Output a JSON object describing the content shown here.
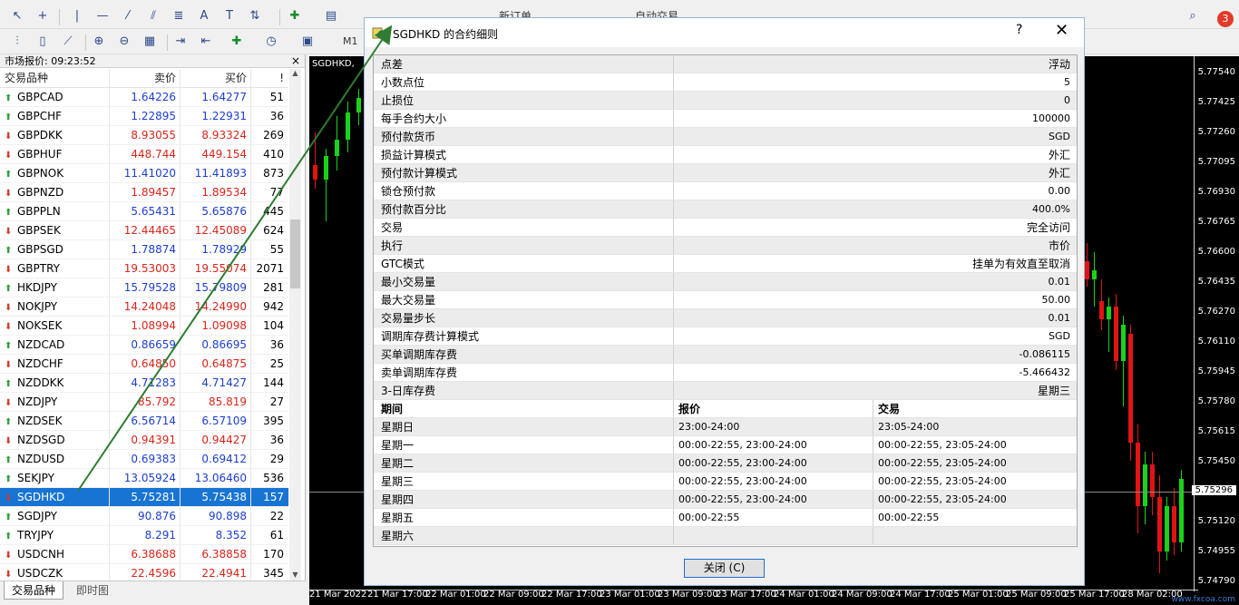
{
  "toolbar1": {
    "new_order": "新订单",
    "auto_trading": "自动交易",
    "font_tool": "A",
    "notification_count": "3"
  },
  "toolbar2": {
    "timeframe": "M1"
  },
  "market_watch": {
    "title": "市场报价: 09:23:52",
    "close": "×",
    "headers": {
      "symbol": "交易品种",
      "bid": "卖价",
      "ask": "买价",
      "spread": "!"
    },
    "rows": [
      {
        "symbol": "GBPCAD",
        "bid": "1.64226",
        "ask": "1.64277",
        "spread": "51",
        "dir": "up",
        "color": "blue"
      },
      {
        "symbol": "GBPCHF",
        "bid": "1.22895",
        "ask": "1.22931",
        "spread": "36",
        "dir": "up",
        "color": "blue"
      },
      {
        "symbol": "GBPDKK",
        "bid": "8.93055",
        "ask": "8.93324",
        "spread": "269",
        "dir": "down",
        "color": "red"
      },
      {
        "symbol": "GBPHUF",
        "bid": "448.744",
        "ask": "449.154",
        "spread": "410",
        "dir": "down",
        "color": "red"
      },
      {
        "symbol": "GBPNOK",
        "bid": "11.41020",
        "ask": "11.41893",
        "spread": "873",
        "dir": "up",
        "color": "blue"
      },
      {
        "symbol": "GBPNZD",
        "bid": "1.89457",
        "ask": "1.89534",
        "spread": "77",
        "dir": "down",
        "color": "red"
      },
      {
        "symbol": "GBPPLN",
        "bid": "5.65431",
        "ask": "5.65876",
        "spread": "445",
        "dir": "up",
        "color": "blue"
      },
      {
        "symbol": "GBPSEK",
        "bid": "12.44465",
        "ask": "12.45089",
        "spread": "624",
        "dir": "down",
        "color": "red"
      },
      {
        "symbol": "GBPSGD",
        "bid": "1.78874",
        "ask": "1.78929",
        "spread": "55",
        "dir": "up",
        "color": "blue"
      },
      {
        "symbol": "GBPTRY",
        "bid": "19.53003",
        "ask": "19.55074",
        "spread": "2071",
        "dir": "down",
        "color": "red"
      },
      {
        "symbol": "HKDJPY",
        "bid": "15.79528",
        "ask": "15.79809",
        "spread": "281",
        "dir": "up",
        "color": "blue"
      },
      {
        "symbol": "NOKJPY",
        "bid": "14.24048",
        "ask": "14.24990",
        "spread": "942",
        "dir": "down",
        "color": "red"
      },
      {
        "symbol": "NOKSEK",
        "bid": "1.08994",
        "ask": "1.09098",
        "spread": "104",
        "dir": "down",
        "color": "red"
      },
      {
        "symbol": "NZDCAD",
        "bid": "0.86659",
        "ask": "0.86695",
        "spread": "36",
        "dir": "up",
        "color": "blue"
      },
      {
        "symbol": "NZDCHF",
        "bid": "0.64850",
        "ask": "0.64875",
        "spread": "25",
        "dir": "down",
        "color": "red"
      },
      {
        "symbol": "NZDDKK",
        "bid": "4.71283",
        "ask": "4.71427",
        "spread": "144",
        "dir": "up",
        "color": "blue"
      },
      {
        "symbol": "NZDJPY",
        "bid": "85.792",
        "ask": "85.819",
        "spread": "27",
        "dir": "down",
        "color": "red"
      },
      {
        "symbol": "NZDSEK",
        "bid": "6.56714",
        "ask": "6.57109",
        "spread": "395",
        "dir": "up",
        "color": "blue"
      },
      {
        "symbol": "NZDSGD",
        "bid": "0.94391",
        "ask": "0.94427",
        "spread": "36",
        "dir": "down",
        "color": "red"
      },
      {
        "symbol": "NZDUSD",
        "bid": "0.69383",
        "ask": "0.69412",
        "spread": "29",
        "dir": "up",
        "color": "blue"
      },
      {
        "symbol": "SEKJPY",
        "bid": "13.05924",
        "ask": "13.06460",
        "spread": "536",
        "dir": "up",
        "color": "blue"
      },
      {
        "symbol": "SGDHKD",
        "bid": "5.75281",
        "ask": "5.75438",
        "spread": "157",
        "dir": "down",
        "color": "blue",
        "selected": true
      },
      {
        "symbol": "SGDJPY",
        "bid": "90.876",
        "ask": "90.898",
        "spread": "22",
        "dir": "up",
        "color": "blue"
      },
      {
        "symbol": "TRYJPY",
        "bid": "8.291",
        "ask": "8.352",
        "spread": "61",
        "dir": "up",
        "color": "blue"
      },
      {
        "symbol": "USDCNH",
        "bid": "6.38688",
        "ask": "6.38858",
        "spread": "170",
        "dir": "down",
        "color": "red"
      },
      {
        "symbol": "USDCZK",
        "bid": "22.4596",
        "ask": "22.4941",
        "spread": "345",
        "dir": "down",
        "color": "red"
      }
    ],
    "tabs": [
      "交易品种",
      "即时图"
    ]
  },
  "chart": {
    "symbol": "SGDHKD,",
    "price_labels": [
      "5.77540",
      "5.77425",
      "5.77260",
      "5.77095",
      "5.76930",
      "5.76765",
      "5.76600",
      "5.76435",
      "5.76270",
      "5.76110",
      "5.75945",
      "5.75780",
      "5.75615",
      "5.75450",
      "5.75120",
      "5.74955",
      "5.74790"
    ],
    "current_price": "5.75296",
    "time_labels": [
      "21 Mar 2022",
      "21 Mar 17:00",
      "22 Mar 01:00",
      "22 Mar 09:00",
      "22 Mar 17:00",
      "23 Mar 01:00",
      "23 Mar 09:00",
      "23 Mar 17:00",
      "24 Mar 01:00",
      "24 Mar 09:00",
      "24 Mar 17:00",
      "25 Mar 01:00",
      "25 Mar 09:00",
      "25 Mar 17:00",
      "28 Mar 02:00"
    ],
    "watermark": "www.fxcoa.com",
    "candles": [
      {
        "o": 5.7703,
        "h": 5.7721,
        "l": 5.769,
        "c": 5.7695
      },
      {
        "o": 5.7695,
        "h": 5.7712,
        "l": 5.7672,
        "c": 5.7708
      },
      {
        "o": 5.7708,
        "h": 5.773,
        "l": 5.77,
        "c": 5.7717
      },
      {
        "o": 5.7717,
        "h": 5.7738,
        "l": 5.771,
        "c": 5.7732
      },
      {
        "o": 5.7732,
        "h": 5.7745,
        "l": 5.7725,
        "c": 5.774
      }
    ],
    "candles_right": [
      {
        "o": 5.765,
        "h": 5.766,
        "l": 5.7636,
        "c": 5.764
      },
      {
        "o": 5.764,
        "h": 5.7655,
        "l": 5.7625,
        "c": 5.7645
      },
      {
        "o": 5.7628,
        "h": 5.764,
        "l": 5.7612,
        "c": 5.7618
      },
      {
        "o": 5.7618,
        "h": 5.763,
        "l": 5.76,
        "c": 5.7625
      },
      {
        "o": 5.7625,
        "h": 5.7632,
        "l": 5.759,
        "c": 5.7595
      },
      {
        "o": 5.7595,
        "h": 5.762,
        "l": 5.757,
        "c": 5.7615
      },
      {
        "o": 5.761,
        "h": 5.7615,
        "l": 5.754,
        "c": 5.755
      },
      {
        "o": 5.755,
        "h": 5.756,
        "l": 5.75,
        "c": 5.7515
      },
      {
        "o": 5.7515,
        "h": 5.7545,
        "l": 5.7505,
        "c": 5.7538
      },
      {
        "o": 5.7538,
        "h": 5.7545,
        "l": 5.751,
        "c": 5.752
      },
      {
        "o": 5.752,
        "h": 5.7532,
        "l": 5.7478,
        "c": 5.749
      },
      {
        "o": 5.749,
        "h": 5.752,
        "l": 5.7485,
        "c": 5.7515
      },
      {
        "o": 5.7515,
        "h": 5.7525,
        "l": 5.7488,
        "c": 5.7495
      },
      {
        "o": 5.7495,
        "h": 5.7535,
        "l": 5.749,
        "c": 5.753
      }
    ]
  },
  "dialog": {
    "title": "SGDHKD 的合约细则",
    "help": "?",
    "close_x": "✕",
    "properties": [
      {
        "key": "点差",
        "value": "浮动"
      },
      {
        "key": "小数点位",
        "value": "5"
      },
      {
        "key": "止损位",
        "value": "0"
      },
      {
        "key": "每手合约大小",
        "value": "100000"
      },
      {
        "key": "预付款货币",
        "value": "SGD"
      },
      {
        "key": "损益计算模式",
        "value": "外汇"
      },
      {
        "key": "预付款计算模式",
        "value": "外汇"
      },
      {
        "key": "锁仓预付款",
        "value": "0.00"
      },
      {
        "key": "预付款百分比",
        "value": "400.0%"
      },
      {
        "key": "交易",
        "value": "完全访问"
      },
      {
        "key": "执行",
        "value": "市价"
      },
      {
        "key": "GTC模式",
        "value": "挂单为有效直至取消"
      },
      {
        "key": "最小交易量",
        "value": "0.01"
      },
      {
        "key": "最大交易量",
        "value": "50.00"
      },
      {
        "key": "交易量步长",
        "value": "0.01"
      },
      {
        "key": "调期库存费计算模式",
        "value": "SGD"
      },
      {
        "key": "买单调期库存费",
        "value": "-0.086115"
      },
      {
        "key": "卖单调期库存费",
        "value": "-5.466432"
      },
      {
        "key": "3-日库存费",
        "value": "星期三"
      }
    ],
    "sessions_header": {
      "day": "期间",
      "quote": "报价",
      "trade": "交易"
    },
    "sessions": [
      {
        "day": "星期日",
        "quote": "23:00-24:00",
        "trade": "23:05-24:00"
      },
      {
        "day": "星期一",
        "quote": "00:00-22:55, 23:00-24:00",
        "trade": "00:00-22:55, 23:05-24:00"
      },
      {
        "day": "星期二",
        "quote": "00:00-22:55, 23:00-24:00",
        "trade": "00:00-22:55, 23:05-24:00"
      },
      {
        "day": "星期三",
        "quote": "00:00-22:55, 23:00-24:00",
        "trade": "00:00-22:55, 23:05-24:00"
      },
      {
        "day": "星期四",
        "quote": "00:00-22:55, 23:00-24:00",
        "trade": "00:00-22:55, 23:05-24:00"
      },
      {
        "day": "星期五",
        "quote": "00:00-22:55",
        "trade": "00:00-22:55"
      },
      {
        "day": "星期六",
        "quote": "",
        "trade": ""
      }
    ],
    "close_button": "关闭 (C)"
  },
  "colors": {
    "bull": "#19d219",
    "bear": "#e01414",
    "accent": "#1874d3",
    "arrow": "#2e7d32"
  }
}
